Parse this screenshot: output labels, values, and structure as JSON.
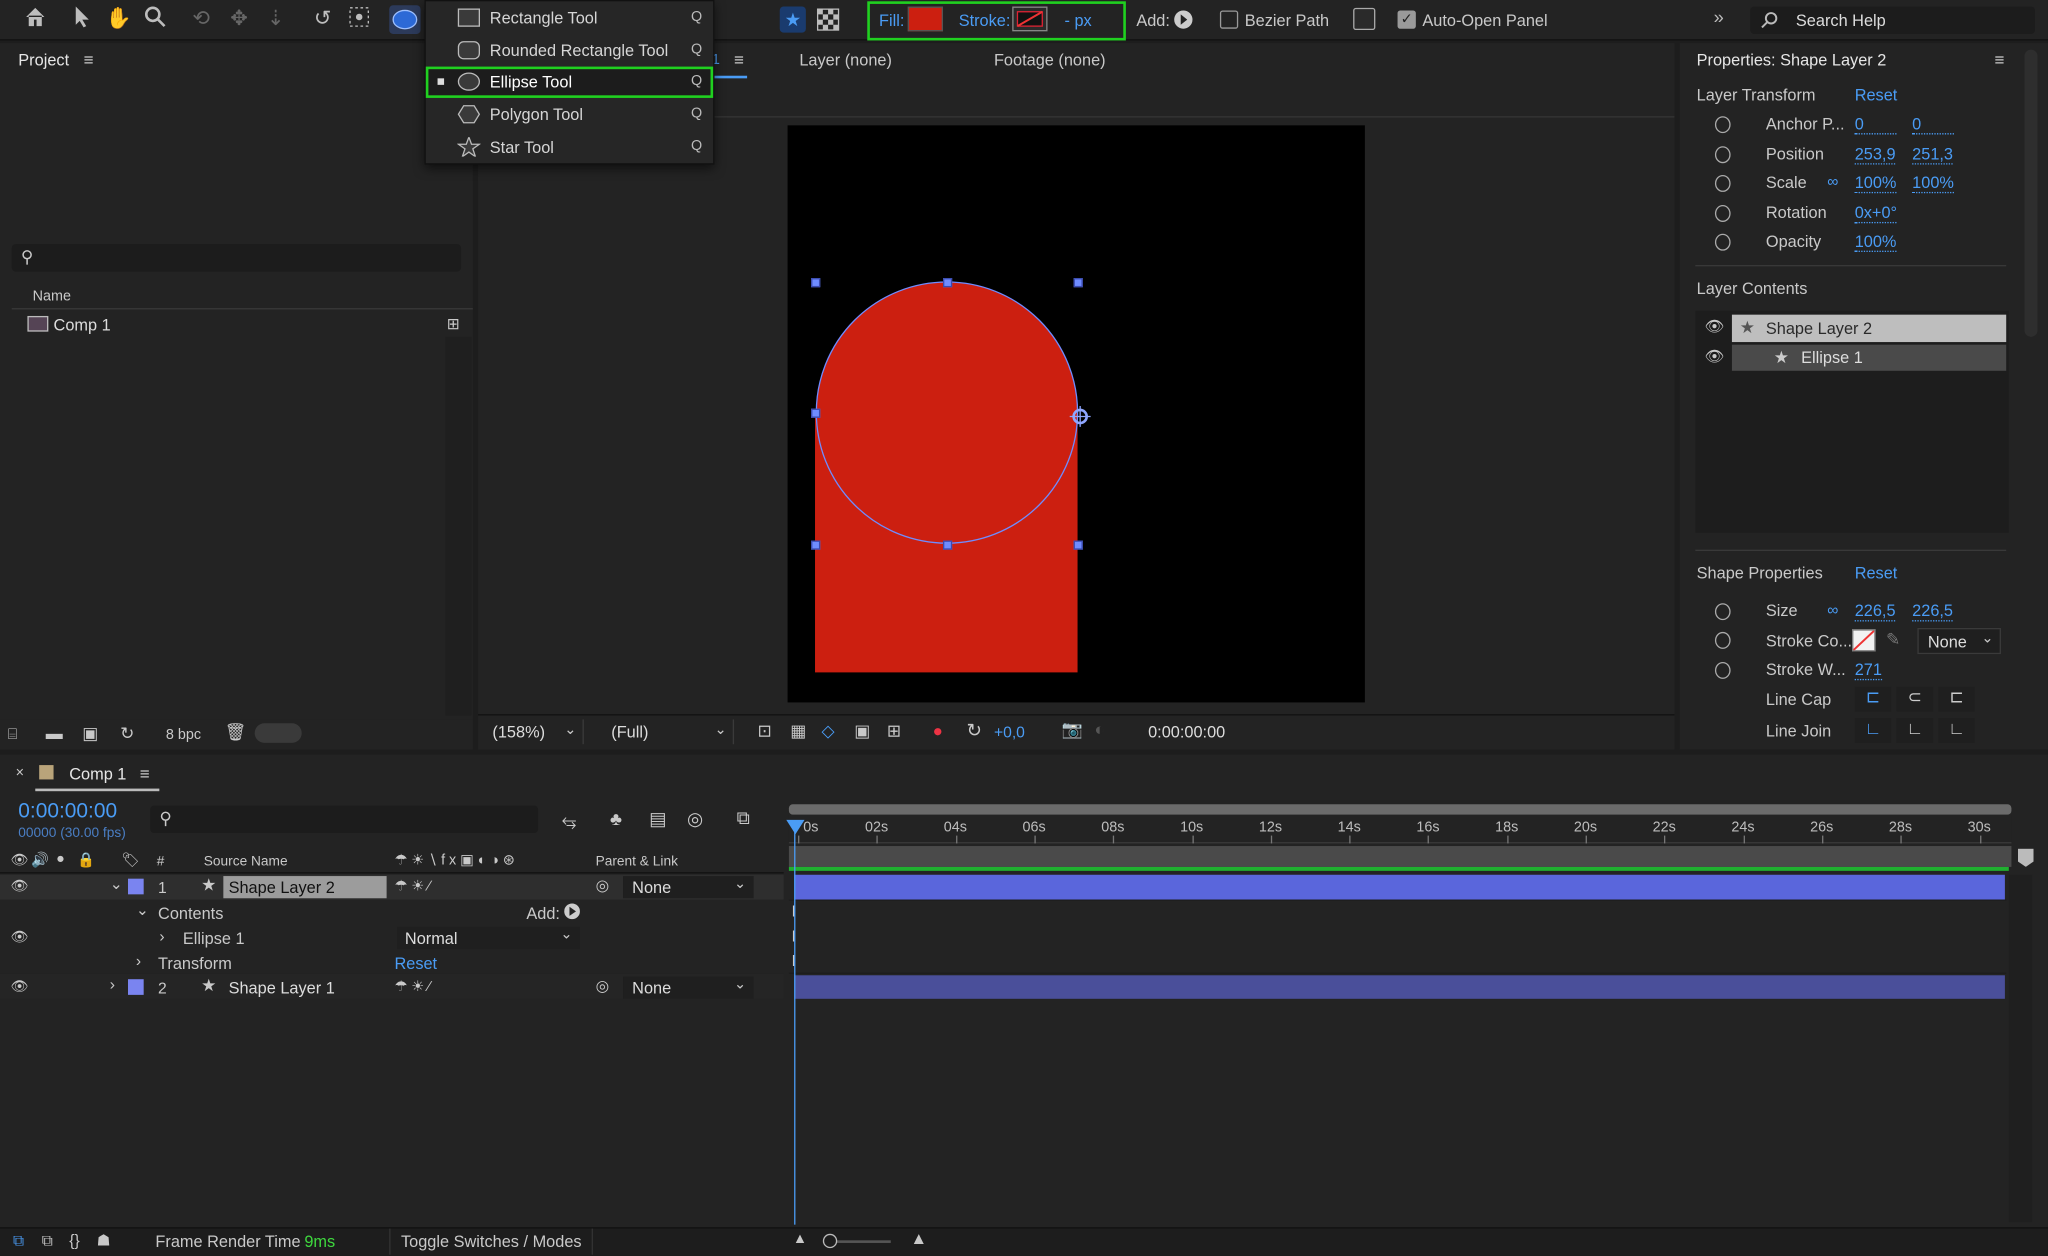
{
  "toolbar": {
    "fill_label": "Fill:",
    "stroke_label": "Stroke:",
    "stroke_px": "- px",
    "add_label": "Add:",
    "bezier_label": "Bezier Path",
    "auto_open_label": "Auto-Open Panel",
    "search_placeholder": "Search Help",
    "fill_color": "#cc1f10"
  },
  "shape_menu": {
    "items": [
      {
        "label": "Rectangle Tool",
        "key": "Q"
      },
      {
        "label": "Rounded Rectangle Tool",
        "key": "Q"
      },
      {
        "label": "Ellipse Tool",
        "key": "Q",
        "selected": true
      },
      {
        "label": "Polygon Tool",
        "key": "Q"
      },
      {
        "label": "Star Tool",
        "key": "Q"
      }
    ]
  },
  "project": {
    "title": "Project",
    "col_name": "Name",
    "item": "Comp 1",
    "bpc": "8 bpc"
  },
  "viewer": {
    "tab_num": "1",
    "layer_tab": "Layer (none)",
    "footage_tab": "Footage (none)",
    "zoom": "(158%)",
    "resolution": "(Full)",
    "exposure": "+0,0",
    "timecode": "0:00:00:00"
  },
  "properties": {
    "title": "Properties: Shape Layer 2",
    "layer_transform": "Layer Transform",
    "reset": "Reset",
    "anchor_label": "Anchor P...",
    "anchor_x": "0",
    "anchor_y": "0",
    "position_label": "Position",
    "position_x": "253,9",
    "position_y": "251,3",
    "scale_label": "Scale",
    "scale_x": "100%",
    "scale_y": "100%",
    "rotation_label": "Rotation",
    "rotation": "0x+0°",
    "opacity_label": "Opacity",
    "opacity": "100%",
    "layer_contents": "Layer Contents",
    "contents_items": [
      "Shape Layer 2",
      "Ellipse 1"
    ],
    "shape_properties": "Shape Properties",
    "shape_reset": "Reset",
    "size_label": "Size",
    "size_x": "226,5",
    "size_y": "226,5",
    "stroke_color_label": "Stroke Co...",
    "stroke_none": "None",
    "stroke_width_label": "Stroke W...",
    "stroke_width": "271",
    "line_cap_label": "Line Cap",
    "line_join_label": "Line Join"
  },
  "timeline": {
    "comp_tab": "Comp 1",
    "timecode": "0:00:00:00",
    "frames": "00000 (30.00 fps)",
    "col_source": "Source Name",
    "col_parent": "Parent & Link",
    "col_hash": "#",
    "ticks": [
      "0s",
      "02s",
      "04s",
      "06s",
      "08s",
      "10s",
      "12s",
      "14s",
      "16s",
      "18s",
      "20s",
      "22s",
      "24s",
      "26s",
      "28s",
      "30s"
    ],
    "layers": [
      {
        "num": "1",
        "name": "Shape Layer 2",
        "parent": "None"
      },
      {
        "num": "2",
        "name": "Shape Layer 1",
        "parent": "None"
      }
    ],
    "contents": "Contents",
    "add": "Add:",
    "ellipse": "Ellipse 1",
    "blend": "Normal",
    "transform": "Transform",
    "reset": "Reset"
  },
  "status": {
    "frame_render_label": "Frame Render Time",
    "frame_render_value": "9ms",
    "toggle": "Toggle Switches / Modes"
  }
}
